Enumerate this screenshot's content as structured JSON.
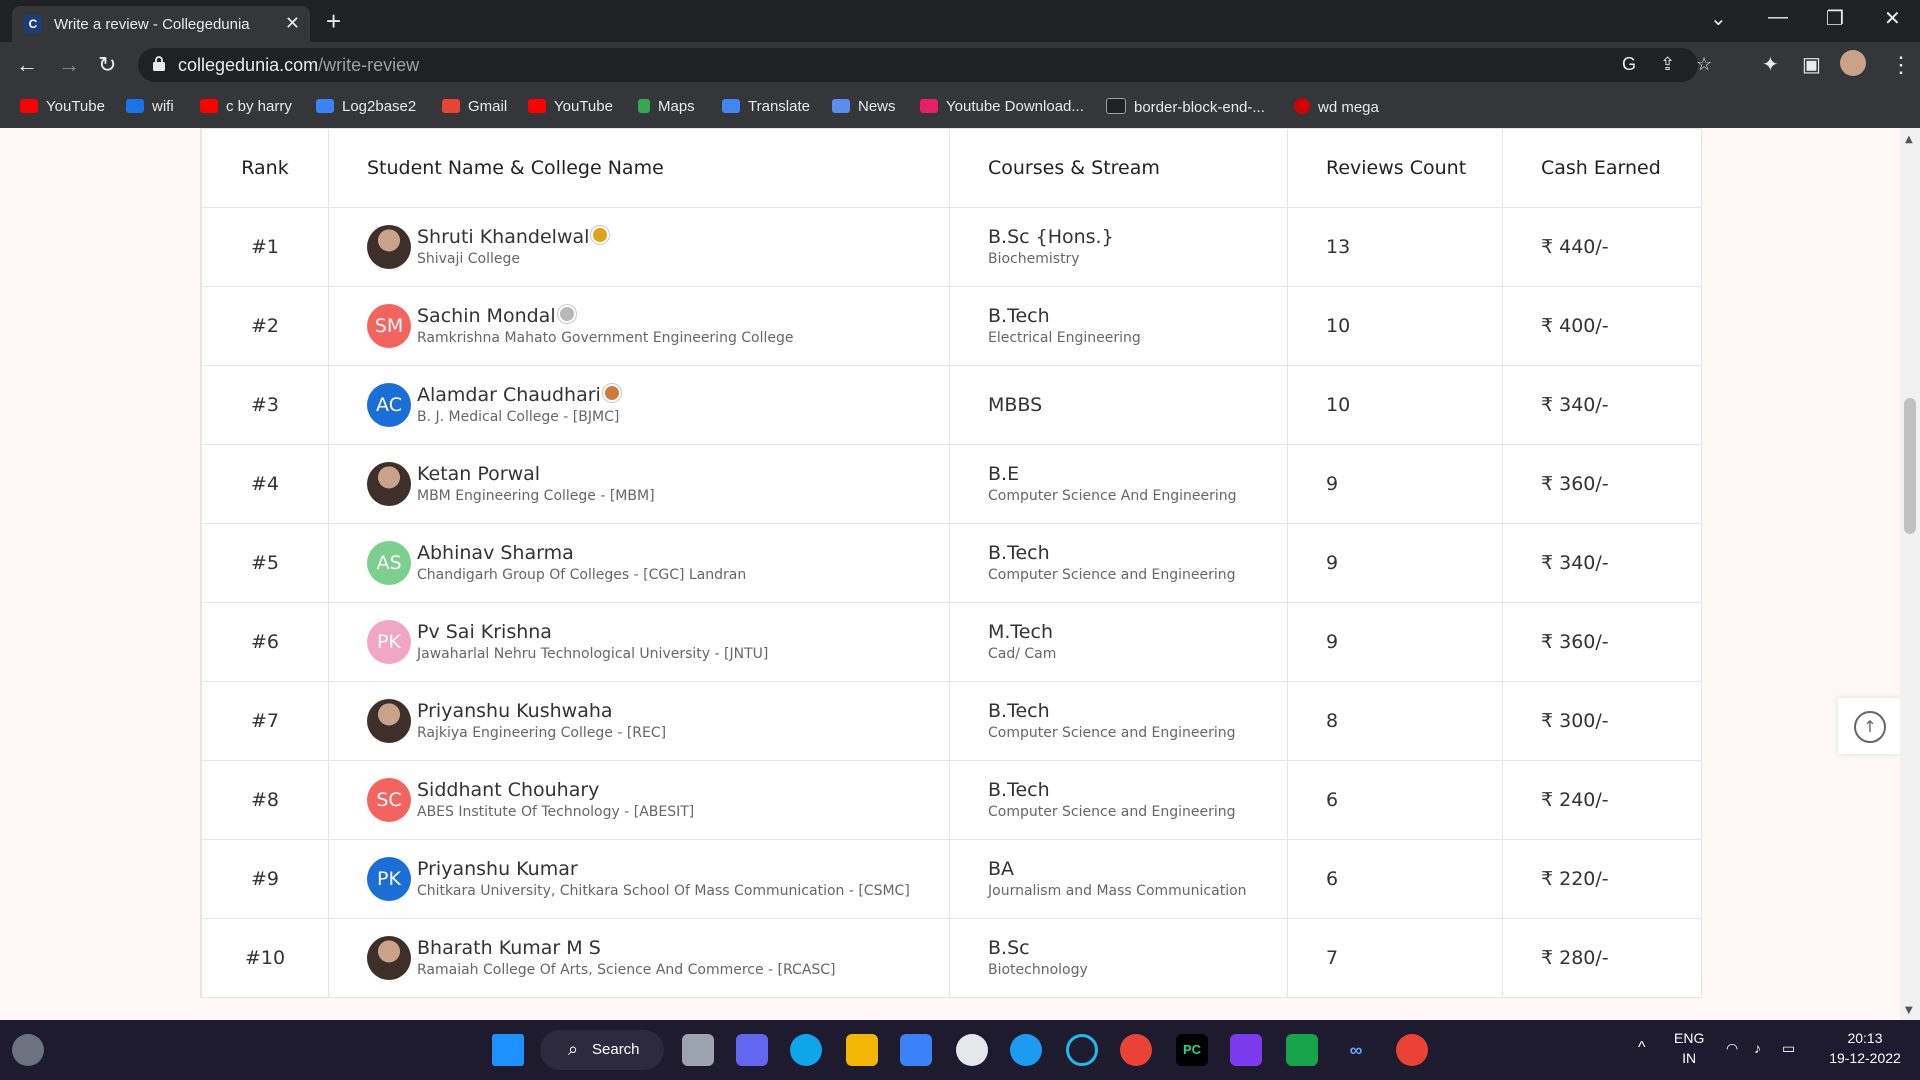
{
  "browser": {
    "tab_title": "Write a review - Collegedunia",
    "tab_favicon": "C",
    "url_host": "collegedunia.com",
    "url_path": "/write-review"
  },
  "bookmarks": [
    {
      "label": "YouTube",
      "color": "#ff0000"
    },
    {
      "label": "wifi",
      "color": "#1a73e8"
    },
    {
      "label": "c by harry",
      "color": "#ff0000"
    },
    {
      "label": "Log2base2",
      "color": "#3b82f6"
    },
    {
      "label": "Gmail",
      "color": "#ea4335"
    },
    {
      "label": "YouTube",
      "color": "#ff0000"
    },
    {
      "label": "Maps",
      "color": "#34a853"
    },
    {
      "label": "Translate",
      "color": "#4285f4"
    },
    {
      "label": "News",
      "color": "#5b8def"
    },
    {
      "label": "Youtube Download...",
      "color": "#e91e63"
    },
    {
      "label": "border-block-end-...",
      "color": "#202124"
    },
    {
      "label": "wd mega",
      "color": "#d50000"
    }
  ],
  "table": {
    "headers": {
      "rank": "Rank",
      "student": "Student Name & College Name",
      "course": "Courses & Stream",
      "reviews": "Reviews Count",
      "cash": "Cash Earned"
    },
    "rows": [
      {
        "rank": "#1",
        "avatar": "",
        "avatar_color": "photo",
        "name": "Shruti Khandelwal",
        "medal": "gold",
        "college": "Shivaji College",
        "course": "B.Sc {Hons.}",
        "stream": "Biochemistry",
        "reviews": "13",
        "cash": "₹ 440/-"
      },
      {
        "rank": "#2",
        "avatar": "SM",
        "avatar_color": "#f4645f",
        "name": "Sachin Mondal",
        "medal": "silver",
        "college": "Ramkrishna Mahato Government Engineering College",
        "course": "B.Tech",
        "stream": "Electrical Engineering",
        "reviews": "10",
        "cash": "₹ 400/-"
      },
      {
        "rank": "#3",
        "avatar": "AC",
        "avatar_color": "#1a6fd6",
        "name": "Alamdar Chaudhari",
        "medal": "bronze",
        "college": "B. J. Medical College - [BJMC]",
        "course": "MBBS",
        "stream": "",
        "reviews": "10",
        "cash": "₹ 340/-"
      },
      {
        "rank": "#4",
        "avatar": "",
        "avatar_color": "photo",
        "name": "Ketan Porwal",
        "medal": "",
        "college": "MBM Engineering College - [MBM]",
        "course": "B.E",
        "stream": "Computer Science And Engineering",
        "reviews": "9",
        "cash": "₹ 360/-"
      },
      {
        "rank": "#5",
        "avatar": "AS",
        "avatar_color": "#7ccf8e",
        "name": "Abhinav Sharma",
        "medal": "",
        "college": "Chandigarh Group Of Colleges - [CGC] Landran",
        "course": "B.Tech",
        "stream": "Computer Science and Engineering",
        "reviews": "9",
        "cash": "₹ 340/-"
      },
      {
        "rank": "#6",
        "avatar": "PK",
        "avatar_color": "#f0a6c4",
        "name": "Pv Sai Krishna",
        "medal": "",
        "college": "Jawaharlal Nehru Technological University - [JNTU]",
        "course": "M.Tech",
        "stream": "Cad/ Cam",
        "reviews": "9",
        "cash": "₹ 360/-"
      },
      {
        "rank": "#7",
        "avatar": "",
        "avatar_color": "photo",
        "name": "Priyanshu Kushwaha",
        "medal": "",
        "college": "Rajkiya Engineering College - [REC]",
        "course": "B.Tech",
        "stream": "Computer Science and Engineering",
        "reviews": "8",
        "cash": "₹ 300/-"
      },
      {
        "rank": "#8",
        "avatar": "SC",
        "avatar_color": "#f4645f",
        "name": "Siddhant Chouhary",
        "medal": "",
        "college": "ABES Institute Of Technology - [ABESIT]",
        "course": "B.Tech",
        "stream": "Computer Science and Engineering",
        "reviews": "6",
        "cash": "₹ 240/-"
      },
      {
        "rank": "#9",
        "avatar": "PK",
        "avatar_color": "#1a6fd6",
        "name": "Priyanshu Kumar",
        "medal": "",
        "college": "Chitkara University, Chitkara School Of Mass Communication - [CSMC]",
        "course": "BA",
        "stream": "Journalism and Mass Communication",
        "reviews": "6",
        "cash": "₹ 220/-"
      },
      {
        "rank": "#10",
        "avatar": "",
        "avatar_color": "photo",
        "name": "Bharath Kumar M S",
        "medal": "",
        "college": "Ramaiah College Of Arts, Science And Commerce - [RCASC]",
        "course": "B.Sc",
        "stream": "Biotechnology",
        "reviews": "7",
        "cash": "₹ 280/-"
      }
    ]
  },
  "taskbar": {
    "search_label": "Search",
    "lang_line1": "ENG",
    "lang_line2": "IN",
    "time": "20:13",
    "date": "19-12-2022",
    "pc_label": "PC"
  }
}
